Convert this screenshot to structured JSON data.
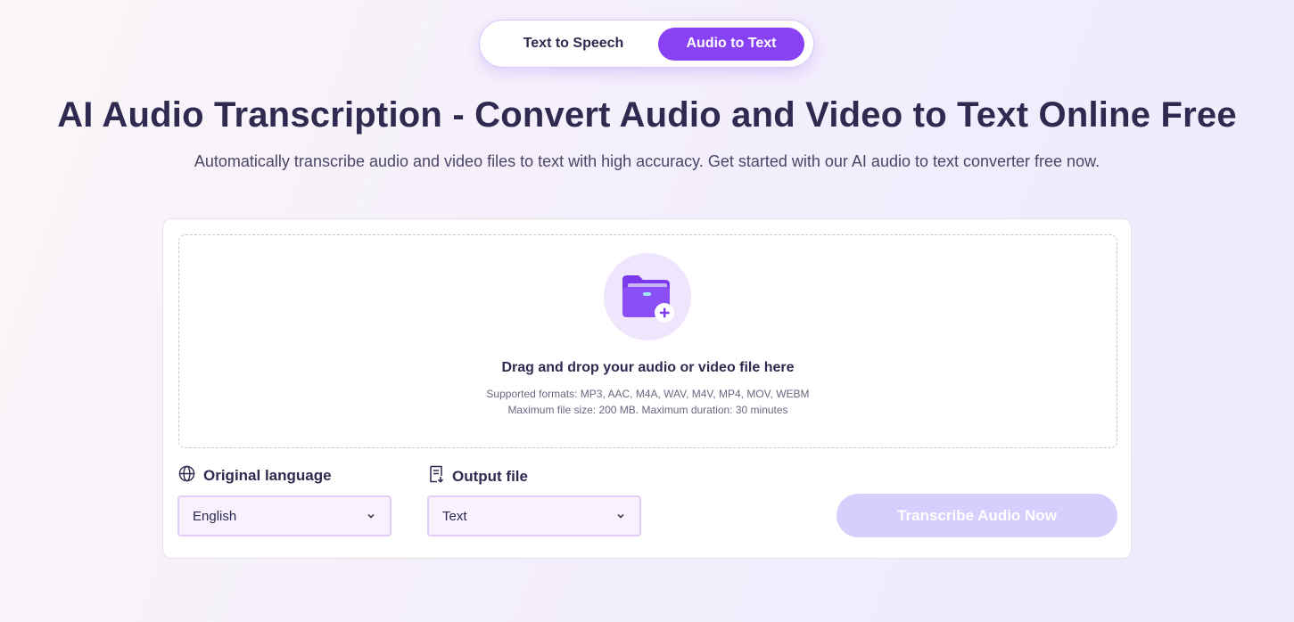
{
  "tabs": [
    {
      "label": "Text to Speech",
      "active": false
    },
    {
      "label": "Audio to Text",
      "active": true
    }
  ],
  "hero": {
    "title": "AI Audio Transcription - Convert Audio and Video to Text Online Free",
    "subtitle": "Automatically transcribe audio and video files to text with high accuracy. Get started with our AI audio to text converter free now."
  },
  "dropzone": {
    "icon": "folder-plus-icon",
    "title": "Drag and drop your audio or video file here",
    "formats": "Supported formats: MP3, AAC, M4A, WAV, M4V, MP4, MOV, WEBM",
    "limits": "Maximum file size: 200 MB. Maximum duration: 30 minutes"
  },
  "language": {
    "icon": "globe-icon",
    "label": "Original language",
    "value": "English"
  },
  "output": {
    "icon": "document-icon",
    "label": "Output file",
    "value": "Text"
  },
  "cta": {
    "label": "Transcribe Audio Now",
    "state": "disabled"
  },
  "colors": {
    "accent": "#8842f4",
    "cta_disabled": "#d7cefd",
    "title": "#2f2a4f"
  }
}
